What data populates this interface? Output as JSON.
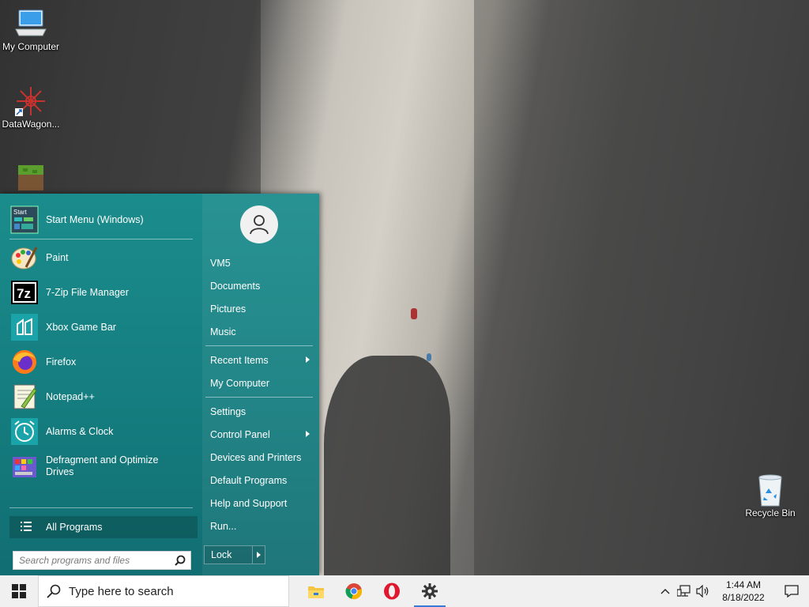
{
  "desktop": {
    "icons": [
      {
        "label": "My Computer",
        "icon": "computer-icon"
      },
      {
        "label": "DataWagon...",
        "icon": "datawagon-icon"
      },
      {
        "label": "",
        "icon": "minecraft-icon"
      },
      {
        "label": "Recycle Bin",
        "icon": "recycle-bin-icon"
      }
    ]
  },
  "start_menu": {
    "pinned": {
      "label": "Start Menu (Windows)",
      "icon": "start-menu-icon"
    },
    "programs": [
      {
        "label": "Paint",
        "icon": "paint-icon"
      },
      {
        "label": "7-Zip File Manager",
        "icon": "7zip-icon"
      },
      {
        "label": "Xbox Game Bar",
        "icon": "xbox-game-bar-icon"
      },
      {
        "label": "Firefox",
        "icon": "firefox-icon"
      },
      {
        "label": "Notepad++",
        "icon": "notepadpp-icon"
      },
      {
        "label": "Alarms & Clock",
        "icon": "alarms-clock-icon"
      },
      {
        "label": "Defragment and Optimize Drives",
        "icon": "defrag-icon"
      }
    ],
    "all_programs": "All Programs",
    "search_placeholder": "Search programs and files",
    "right": {
      "user": "VM5",
      "group1": [
        "Documents",
        "Pictures",
        "Music"
      ],
      "group2": [
        "Recent Items",
        "My Computer"
      ],
      "group3": [
        "Settings",
        "Control Panel",
        "Devices and Printers",
        "Default Programs",
        "Help and Support",
        "Run..."
      ]
    },
    "lock_label": "Lock"
  },
  "taskbar": {
    "search_placeholder": "Type here to search",
    "apps": [
      "file-explorer-icon",
      "chrome-icon",
      "opera-icon",
      "settings-icon"
    ],
    "clock": {
      "time": "1:44 AM",
      "date": "8/18/2022"
    }
  },
  "colors": {
    "start_menu_bg": "#157d7f",
    "taskbar_bg": "#f0f0f0"
  }
}
